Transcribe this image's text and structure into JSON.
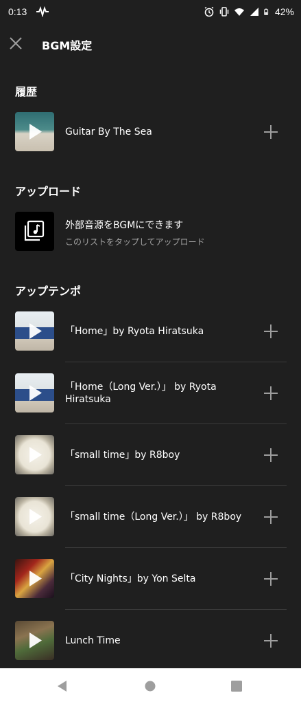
{
  "status_bar": {
    "time": "0:13",
    "battery_percent": "42%",
    "icons": [
      "activity-wave-icon",
      "alarm-icon",
      "vibrate-icon",
      "wifi-icon",
      "signal-icon",
      "battery-icon"
    ]
  },
  "header": {
    "title": "BGM設定",
    "close_icon": "close-icon"
  },
  "sections": {
    "history": {
      "title": "履歴",
      "items": [
        {
          "title": "Guitar By The Sea"
        }
      ]
    },
    "upload": {
      "title": "アップロード",
      "item": {
        "title": "外部音源をBGMにできます",
        "subtitle": "このリストをタップしてアップロード",
        "icon": "music-library-icon"
      }
    },
    "up_tempo": {
      "title": "アップテンポ",
      "items": [
        {
          "title": "「Home」by Ryota Hiratsuka"
        },
        {
          "title": "「Home（Long Ver.）」 by Ryota Hiratsuka"
        },
        {
          "title": "「small time」by R8boy"
        },
        {
          "title": "「small time（Long Ver.）」 by R8boy"
        },
        {
          "title": "「City Nights」by Yon Selta"
        },
        {
          "title": "Lunch Time"
        }
      ]
    }
  },
  "colors": {
    "background": "#1f1f1f",
    "text_primary": "#ffffff",
    "text_secondary": "#a0a0a0",
    "divider": "#3a3a3a",
    "icon": "#9e9e9e",
    "nav_bar": "#ffffff"
  },
  "nav_bar": {
    "icons": [
      "back-icon",
      "home-icon",
      "recents-icon"
    ]
  }
}
